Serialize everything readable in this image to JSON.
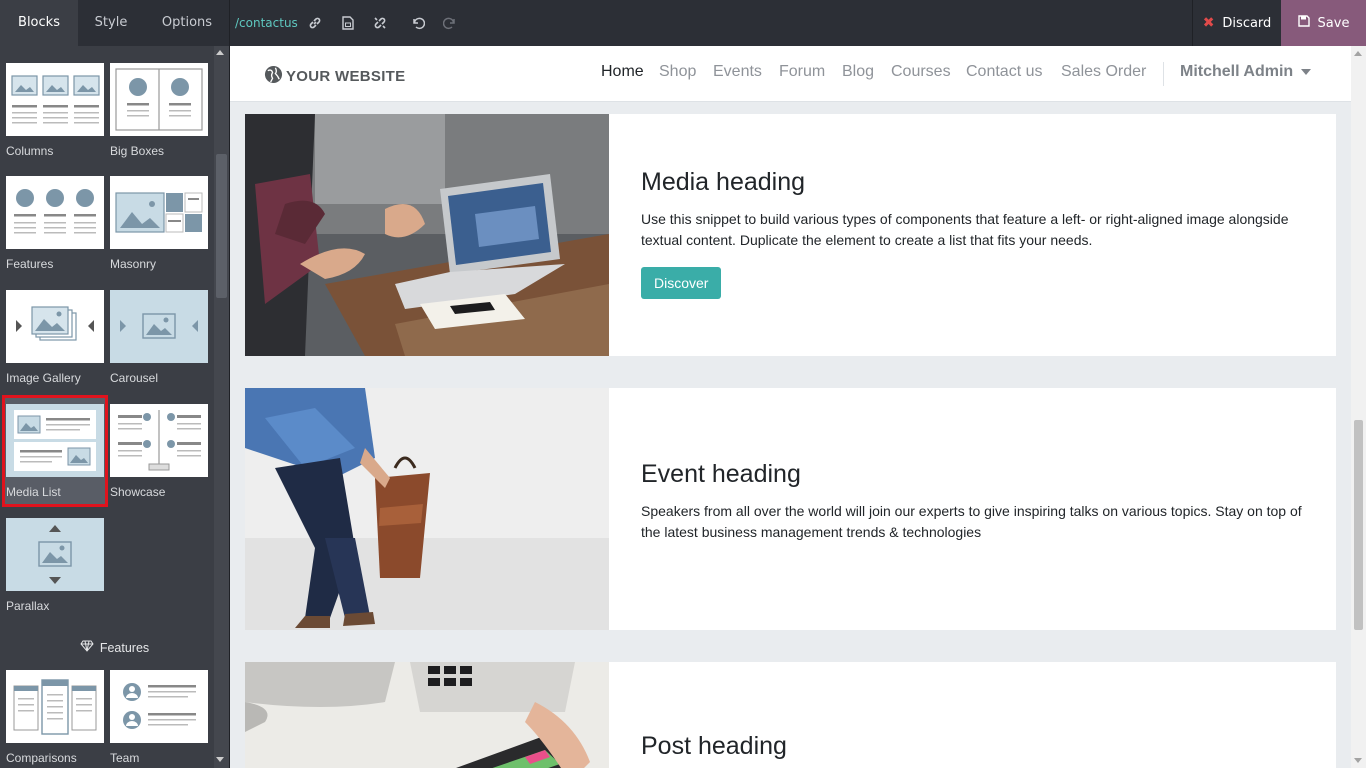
{
  "editor": {
    "tabs": [
      {
        "label": "Blocks",
        "active": true
      },
      {
        "label": "Style",
        "active": false
      },
      {
        "label": "Options",
        "active": false
      }
    ],
    "url": "/contactus",
    "discard_label": "Discard",
    "save_label": "Save",
    "colors": {
      "bar": "#2c2f36",
      "panel": "#3b3e45",
      "save": "#875a7b",
      "url": "#5fc8c0",
      "selection": "#e0131d"
    }
  },
  "blocks_panel": {
    "blocks": [
      {
        "label": "Columns"
      },
      {
        "label": "Big Boxes"
      },
      {
        "label": "Features"
      },
      {
        "label": "Masonry"
      },
      {
        "label": "Image Gallery"
      },
      {
        "label": "Carousel"
      },
      {
        "label": "Media List",
        "selected": true
      },
      {
        "label": "Showcase"
      },
      {
        "label": "Parallax"
      },
      {
        "label": "Comparisons"
      },
      {
        "label": "Team"
      }
    ],
    "section_title": "Features"
  },
  "website": {
    "logo_text": "YOUR WEBSITE",
    "nav": [
      {
        "label": "Home",
        "active": true
      },
      {
        "label": "Shop"
      },
      {
        "label": "Events"
      },
      {
        "label": "Forum"
      },
      {
        "label": "Blog"
      },
      {
        "label": "Courses"
      },
      {
        "label": "Contact us"
      },
      {
        "label": "Sales Order"
      }
    ],
    "user": "Mitchell Admin",
    "media_items": [
      {
        "heading": "Media heading",
        "text": "Use this snippet to build various types of components that feature a left- or right-aligned image alongside textual content. Duplicate the element to create a list that fits your needs.",
        "button": "Discover"
      },
      {
        "heading": "Event heading",
        "text": "Speakers from all over the world will join our experts to give inspiring talks on various topics. Stay on top of the latest business management trends & technologies"
      },
      {
        "heading": "Post heading"
      }
    ],
    "accent": "#3aada8"
  }
}
